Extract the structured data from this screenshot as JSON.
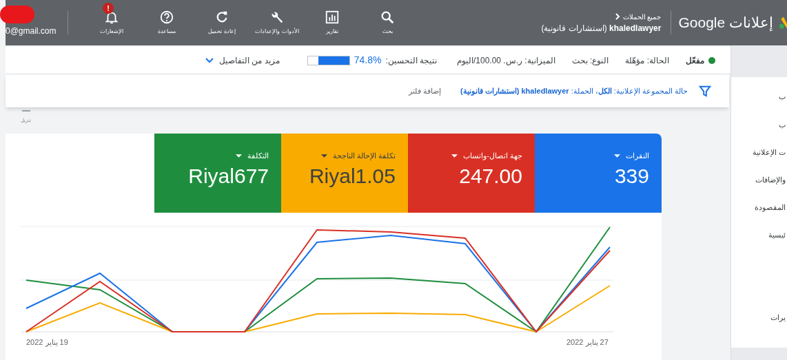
{
  "header": {
    "logo_text": "إعلانات Google",
    "breadcrumb": "جميع الحملات",
    "campaign": "**khaledlawyer** (استشارات قانونية)",
    "tools": [
      {
        "kind": "search",
        "label": "بحث"
      },
      {
        "kind": "reports",
        "label": "تقارير"
      },
      {
        "kind": "tools",
        "label": "الأدوات والإعدادات"
      },
      {
        "kind": "refresh",
        "label": "إعادة تحميل"
      },
      {
        "kind": "help",
        "label": "مساعدة"
      },
      {
        "kind": "notifications",
        "label": "الإشعارات",
        "badge": "!"
      }
    ],
    "account_email": "0@gmail.com"
  },
  "status_bar": {
    "status": {
      "label": "مفعّل",
      "color": "#1e8e3e"
    },
    "fields": [
      "الحالة: مؤهّلة",
      "النوع: بحث",
      "الميزانية: ر.س. 100.00/اليوم"
    ],
    "optimization_label": "نتيجة التحسين:",
    "optimization_value": "74.8%",
    "level": 0.748,
    "more_details": "مزيد من التفاصيل"
  },
  "filter_bar": {
    "filter": "حالة المجموعة الإعلانية: **الكل**، الحملة: **khaledlawyer (استشارات قانونية)**",
    "add_filter": "إضافة فلتر"
  },
  "download": "تنزيل",
  "scorecards": [
    {
      "label": "النقرات",
      "value": "339",
      "color": "#1a73e8"
    },
    {
      "label": "جهة اتصال-واتساب",
      "value": "247.00",
      "color": "#d93025"
    },
    {
      "label": "تكلفة الإحالة الناجحة",
      "value": "Riyal1.05",
      "color": "#f9ab00"
    },
    {
      "label": "التكلفة",
      "value": "Riyal677",
      "color": "#1e8e3e"
    }
  ],
  "chart": {
    "x_start": "19 يناير 2022",
    "x_end": "27 يناير 2022"
  },
  "sidebar": {
    "items": [
      "ب",
      "ب",
      "ت الإعلانية",
      "والإضافات",
      "المقصودة",
      "ئيسية",
      "يرات"
    ]
  }
}
